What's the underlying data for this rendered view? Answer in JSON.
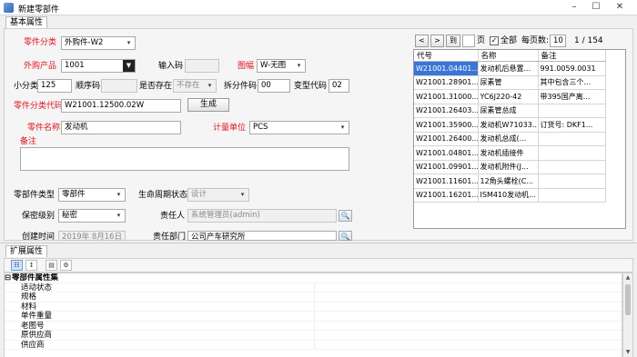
{
  "window": {
    "title": "新建零部件",
    "min": "–",
    "max": "☐",
    "close": "✕"
  },
  "tabs": {
    "basic": "基本属性"
  },
  "form": {
    "part_category_label": "零件分类",
    "part_category_value": "外购件-W2",
    "outsourced_label": "外购产品",
    "outsourced_value": "1001",
    "input_code_label": "输入码",
    "input_code_value": "",
    "drawing_label": "图幅",
    "drawing_value": "W-无图",
    "subclass_label": "小分类",
    "subclass_value": "125",
    "seq_label": "顺序码",
    "seq_value": "",
    "exists_label": "是否存在",
    "exists_value": "不存在",
    "split_label": "拆分件码",
    "split_value": "00",
    "variant_label": "变型代码",
    "variant_value": "02",
    "class_code_label": "零件分类代码",
    "class_code_value": "W21001.12500.02W",
    "generate_label": "生成",
    "part_name_label": "零件名称",
    "part_name_value": "发动机",
    "unit_label": "计量单位",
    "unit_value": "PCS",
    "remark_label": "备注",
    "remark_value": "",
    "type_label": "零部件类型",
    "type_value": "零部件",
    "lifecycle_label": "生命周期状态",
    "lifecycle_value": "设计",
    "secret_label": "保密级别",
    "secret_value": "秘密",
    "owner_label": "责任人",
    "owner_value": "系统管理员(admin)",
    "created_label": "创建时间",
    "created_value": "2019年 8月16日",
    "dept_label": "责任部门",
    "dept_value": "公司产车研究所"
  },
  "grid": {
    "nav_prev": "<",
    "nav_next": ">",
    "goto_label": "到",
    "page_input": "",
    "page_label": "页",
    "all_label": "全部",
    "all_checked": "✓",
    "per_page_label": "每页数:",
    "per_page_value": "10",
    "page_info": "1  /  154",
    "headers": [
      "代号",
      "名称",
      "备注"
    ],
    "rows": [
      [
        "W21001.04401...",
        "发动机后悬置...",
        "991.0059.0031"
      ],
      [
        "W21001.28901...",
        "尿素管",
        "其中包含三个..."
      ],
      [
        "W21001.31000...",
        "YC6J220-42",
        "带395国产离..."
      ],
      [
        "W21001.26403...",
        "尿素管总成",
        ""
      ],
      [
        "W21001.35900...",
        "发动机W71033...",
        "订货号: DKF1..."
      ],
      [
        "W21001.26400...",
        "发动机总成(...",
        ""
      ],
      [
        "W21001.04801...",
        "发动机插接件",
        ""
      ],
      [
        "W21001.09901...",
        "发动机附件(J...",
        ""
      ],
      [
        "W21001.11601...",
        "12角头螺栓(C...",
        ""
      ],
      [
        "W21001.16201...",
        "ISM410发动机...",
        ""
      ]
    ]
  },
  "ext": {
    "tab": "扩展属性",
    "category": "零部件属性集",
    "props": [
      "适动状态",
      "规格",
      "材料",
      "单件重量",
      "老图号",
      "原供应商",
      "供应商"
    ]
  }
}
